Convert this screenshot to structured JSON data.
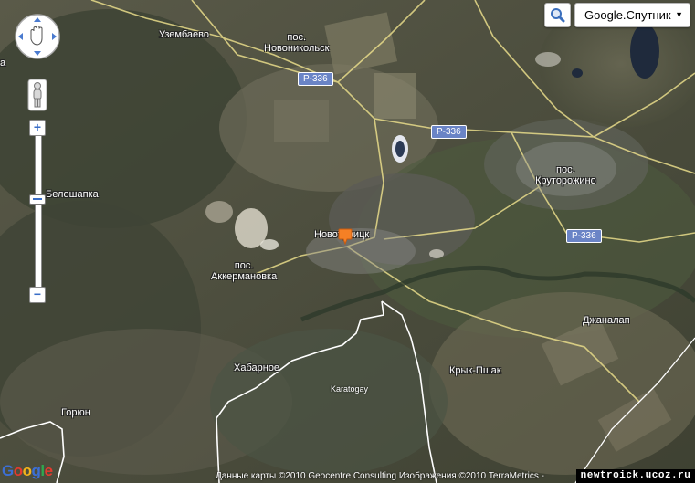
{
  "map": {
    "places": [
      {
        "id": "uzembaevo",
        "text": "Узембаево"
      },
      {
        "id": "novonikolsk",
        "text": "пос.\nНовоникольск"
      },
      {
        "id": "beloshapka",
        "text": "Белошапка"
      },
      {
        "id": "novotroitsk",
        "text": "Новотроицк"
      },
      {
        "id": "akkermanovka",
        "text": "пос.\nАккермановка"
      },
      {
        "id": "krutorozhino",
        "text": "пос.\nКруторожино"
      },
      {
        "id": "dzhanatalap",
        "text": "Джаналап"
      },
      {
        "id": "khabarnoe",
        "text": "Хабарное"
      },
      {
        "id": "kryk-pshak",
        "text": "Крык-Пшак"
      },
      {
        "id": "goryun",
        "text": "Горюн"
      },
      {
        "id": "karatogay",
        "text": "Karatogay"
      }
    ],
    "road_shields": [
      "Р-336",
      "Р-336",
      "Р-336"
    ],
    "edge_glyph": "а"
  },
  "controls": {
    "search_icon": "magnifier-icon",
    "map_type_label": "Google.Спутник",
    "map_type_caret": "▼",
    "zoom_in_label": "+",
    "zoom_out_label": "−",
    "pan_icon": "hand-pan-icon",
    "street_view_icon": "pegman-icon"
  },
  "footer": {
    "logo_text": "Google",
    "attribution": "Данные карты ©2010 Geocentre Consulting Изображения ©2010 TerraMetrics -",
    "watermark": "newtroick.ucoz.ru"
  },
  "colors": {
    "road": "#e8dc8a",
    "river": "#ffffff",
    "shield": "#6a84c6",
    "marker": "#f58025"
  }
}
